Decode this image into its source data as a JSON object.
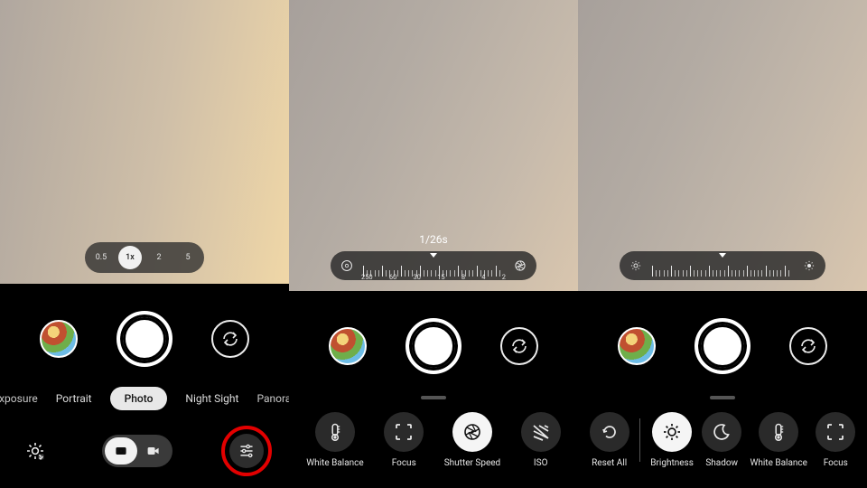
{
  "panel1": {
    "zoom": [
      "0.5",
      "1x",
      "2",
      "5"
    ],
    "zoom_active_index": 1,
    "modes": [
      "Long Exposure",
      "Portrait",
      "Photo",
      "Night Sight",
      "Panorama"
    ],
    "modes_active_index": 2
  },
  "panel2": {
    "readout": "1/26s",
    "shutter_ticks": [
      "250",
      "60",
      "30",
      "15",
      "8",
      "4",
      "2"
    ],
    "controls": [
      {
        "id": "white-balance",
        "label": "White Balance",
        "icon": "thermometer"
      },
      {
        "id": "focus",
        "label": "Focus",
        "icon": "focus"
      },
      {
        "id": "shutter-speed",
        "label": "Shutter Speed",
        "icon": "aperture",
        "active": true
      },
      {
        "id": "iso",
        "label": "ISO",
        "icon": "iso"
      }
    ]
  },
  "panel3": {
    "controls": [
      {
        "id": "reset-all",
        "label": "Reset All",
        "icon": "reset"
      },
      {
        "id": "brightness",
        "label": "Brightness",
        "icon": "sun",
        "active": true
      },
      {
        "id": "shadow",
        "label": "Shadow",
        "icon": "moon"
      },
      {
        "id": "white-balance",
        "label": "White Balance",
        "icon": "thermometer"
      },
      {
        "id": "focus",
        "label": "Focus",
        "icon": "focus"
      }
    ],
    "separator_after_index": 0
  }
}
